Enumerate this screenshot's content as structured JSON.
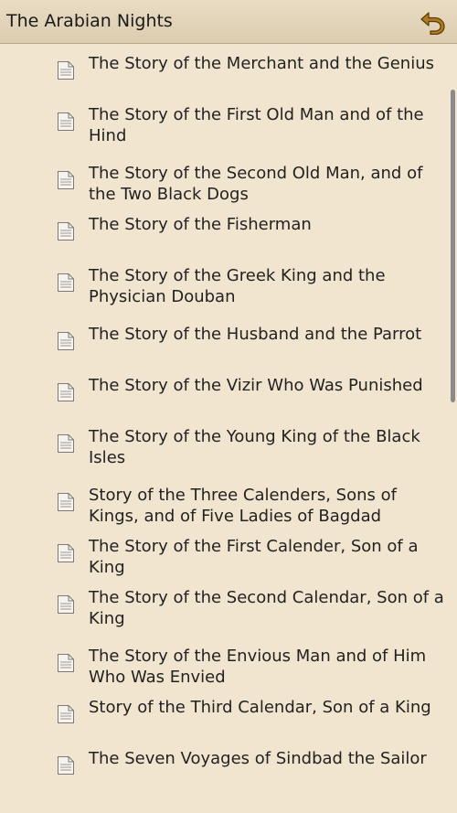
{
  "header": {
    "title": "The Arabian Nights",
    "back_icon": "back-arrow-icon",
    "accent": "#b07a1e"
  },
  "stories": [
    {
      "label": "The Story of the Merchant and the Genius"
    },
    {
      "label": "The Story of the First Old Man and of the Hind"
    },
    {
      "label": "The Story of the Second Old Man, and of the Two Black Dogs"
    },
    {
      "label": "The Story of the Fisherman"
    },
    {
      "label": "The Story of the Greek King and the Physician Douban"
    },
    {
      "label": "The Story of the Husband and the Parrot"
    },
    {
      "label": "The Story of the Vizir Who Was Punished"
    },
    {
      "label": "The Story of the Young King of the Black Isles"
    },
    {
      "label": "Story of the Three Calenders, Sons of Kings, and of Five Ladies of Bagdad"
    },
    {
      "label": "The Story of the First Calender, Son of a King"
    },
    {
      "label": "The Story of the Second Calendar, Son of a King"
    },
    {
      "label": "The Story of the Envious Man and of Him Who Was Envied"
    },
    {
      "label": "Story of the Third Calendar, Son of a King"
    },
    {
      "label": "The Seven Voyages of Sindbad the Sailor"
    }
  ]
}
